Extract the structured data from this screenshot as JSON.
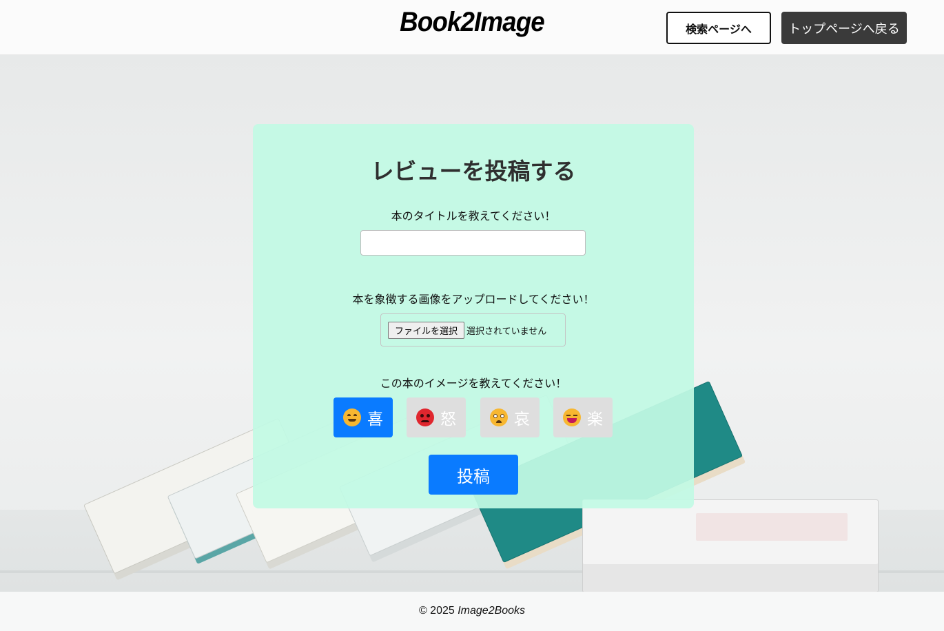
{
  "header": {
    "logo": "Book2Image",
    "search_button": "検索ページへ",
    "top_button": "トップページへ戻る"
  },
  "form": {
    "title": "レビューを投稿する",
    "book_title_label": "本のタイトルを教えてください！",
    "book_title_value": "",
    "image_label": "本を象徴する画像をアップロードしてください！",
    "file_button": "ファイルを選択",
    "file_status": "選択されていません",
    "emotion_label": "この本のイメージを教えてください！",
    "emotions": [
      {
        "label": "喜",
        "icon": "smiling-face-icon",
        "selected": true
      },
      {
        "label": "怒",
        "icon": "angry-face-icon",
        "selected": false
      },
      {
        "label": "哀",
        "icon": "sad-face-icon",
        "selected": false
      },
      {
        "label": "楽",
        "icon": "laughing-face-icon",
        "selected": false
      }
    ],
    "submit": "投稿"
  },
  "footer": {
    "copyright": "© 2025",
    "brand": "Image2Books"
  },
  "colors": {
    "card_bg": "#c2fae4",
    "primary": "#0a7bff",
    "dark_button": "#3a3a3a",
    "inactive_emotion": "#dedede"
  }
}
